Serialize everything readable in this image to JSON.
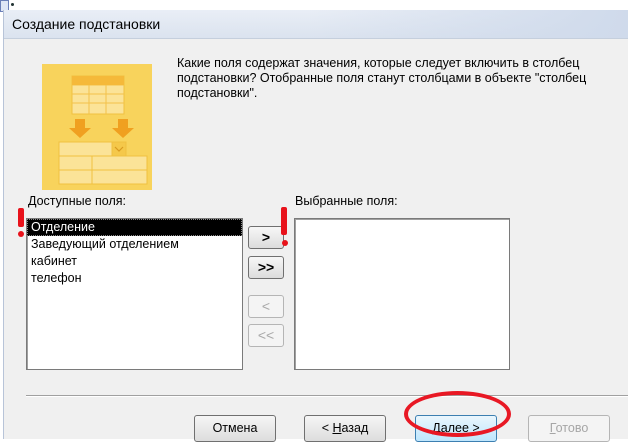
{
  "window": {
    "title": "Создание подстановки"
  },
  "description": "Какие поля содержат значения, которые следует включить в столбец подстановки? Отобранные поля станут столбцами в объекте \"столбец подстановки\".",
  "available": {
    "label": "Доступные поля:",
    "items": [
      "Отделение",
      "Заведующий отделением",
      "кабинет",
      "телефон"
    ],
    "selected_index": 0
  },
  "selected": {
    "label": "Выбранные поля:",
    "items": []
  },
  "move_buttons": {
    "add_one": ">",
    "add_all": ">>",
    "remove_one": "<",
    "remove_all": "<<"
  },
  "footer": {
    "cancel": "Отмена",
    "back_prefix": "< ",
    "back_hotkey": "Н",
    "back_rest": "азад",
    "next_hotkey": "Д",
    "next_rest": "алее >",
    "finish_hotkey": "Г",
    "finish_rest": "отово"
  },
  "colors": {
    "illustration": "#f5c84a",
    "annotation": "#e8121b",
    "default_button": "#bee6fd"
  }
}
